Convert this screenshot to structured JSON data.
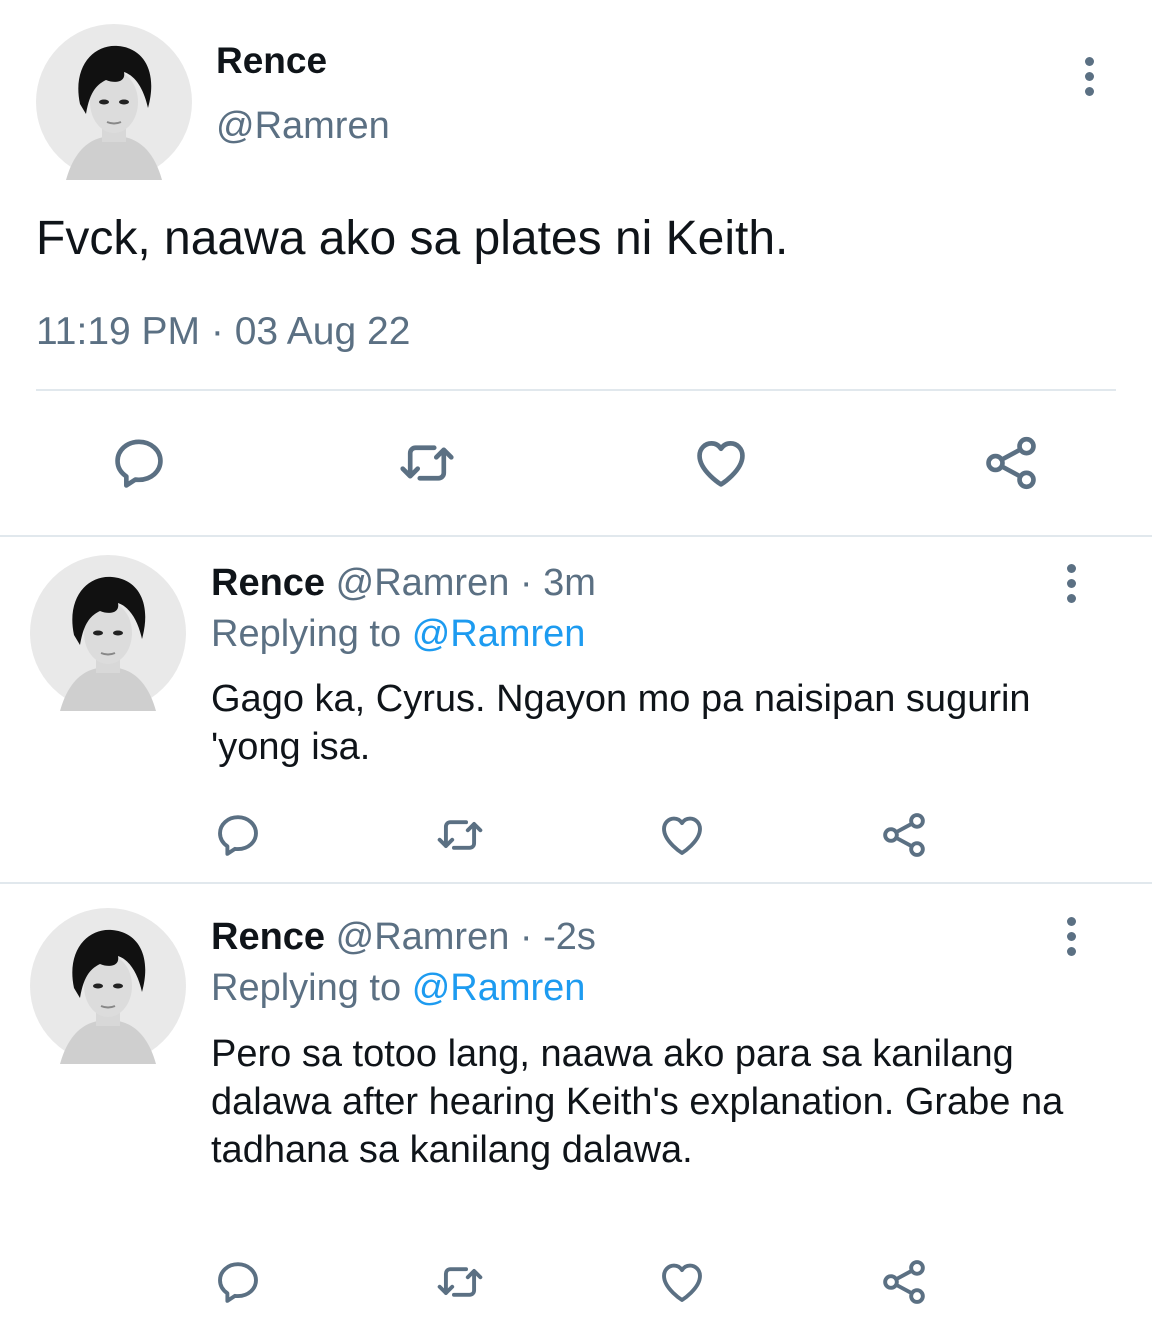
{
  "main_tweet": {
    "name": "Rence",
    "handle": "@Ramren",
    "text": "Fvck, naawa ako sa plates ni Keith.",
    "time": "11:19 PM",
    "separator": "·",
    "date": "03 Aug 22",
    "actions": [
      "reply-icon",
      "retweet-icon",
      "like-icon",
      "share-icon"
    ]
  },
  "replies": [
    {
      "name": "Rence",
      "handle": "@Ramren",
      "separator": "·",
      "time": "3m",
      "replying_label": "Replying to",
      "replying_to": "@Ramren",
      "text": "Gago ka, Cyrus. Ngayon mo pa naisipan sugurin 'yong isa."
    },
    {
      "name": "Rence",
      "handle": "@Ramren",
      "separator": "·",
      "time": "-2s",
      "replying_label": "Replying to",
      "replying_to": "@Ramren",
      "text": "Pero sa totoo lang, naawa ako para sa kanilang dalawa after hearing Keith's explanation. Grabe na tadhana sa kanilang dalawa."
    }
  ],
  "colors": {
    "text": "#0f1419",
    "muted": "#5b7083",
    "link": "#1d9bf0",
    "divider": "#e1e8ed"
  }
}
